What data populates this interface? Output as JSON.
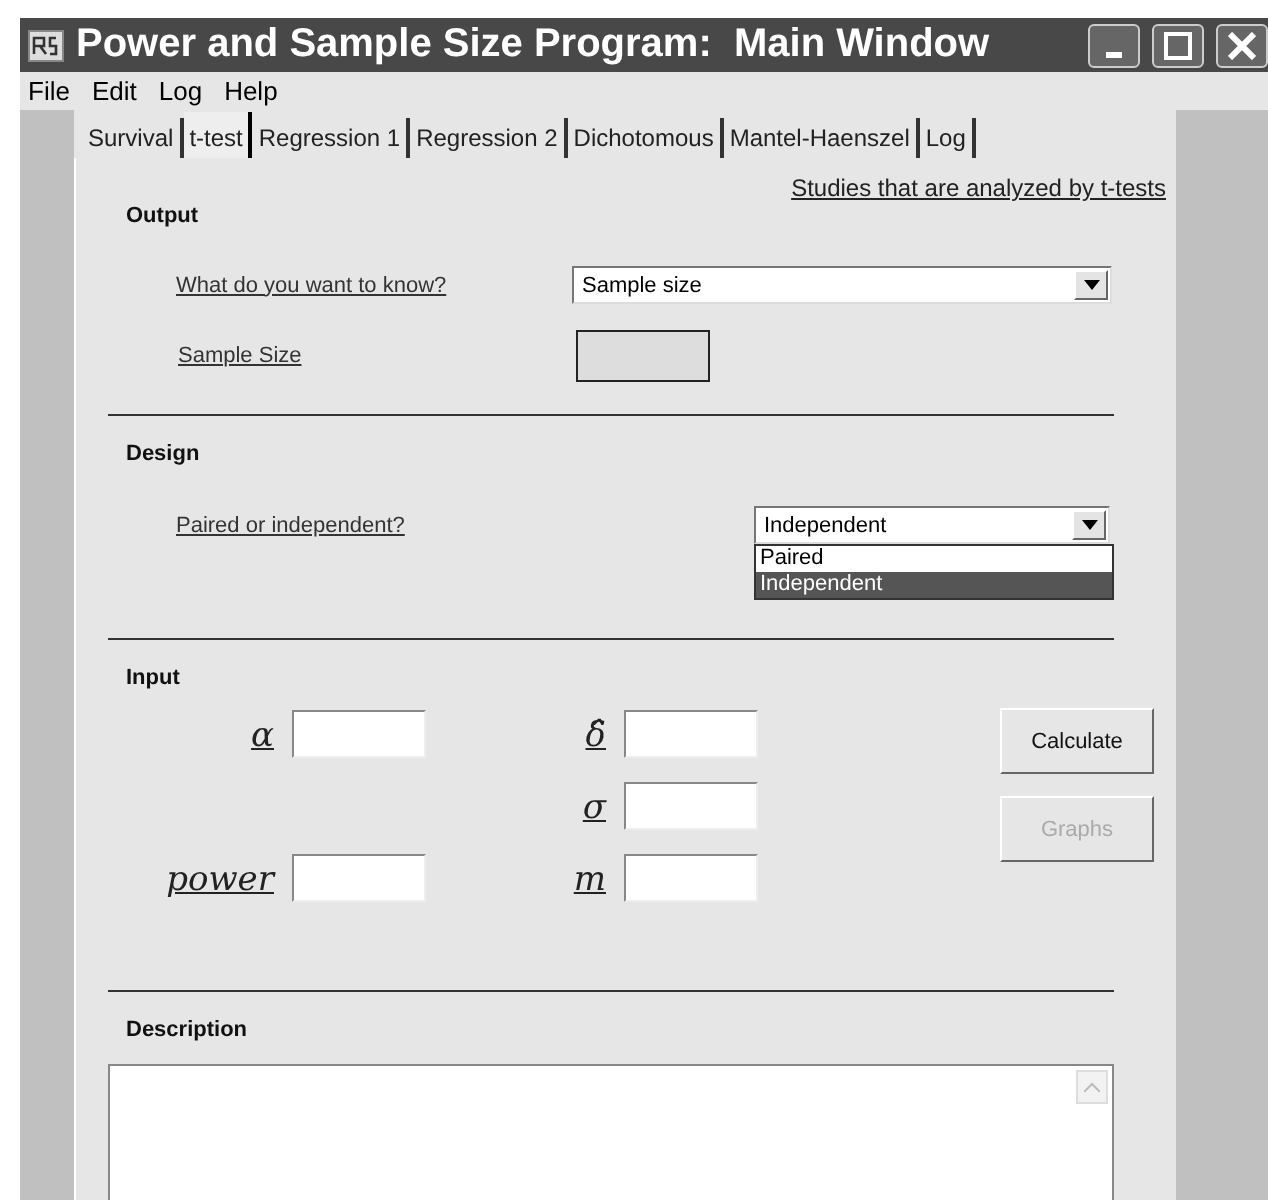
{
  "window": {
    "title": "Power and Sample Size Program:  Main Window"
  },
  "menu": [
    "File",
    "Edit",
    "Log",
    "Help"
  ],
  "tabs": [
    {
      "label": "Survival",
      "selected": false
    },
    {
      "label": "t-test",
      "selected": true
    },
    {
      "label": "Regression 1",
      "selected": false
    },
    {
      "label": "Regression 2",
      "selected": false
    },
    {
      "label": "Dichotomous",
      "selected": false
    },
    {
      "label": "Mantel-Haenszel",
      "selected": false
    },
    {
      "label": "Log",
      "selected": false
    }
  ],
  "link": "Studies that are analyzed by t-tests",
  "output": {
    "heading": "Output",
    "question": {
      "label": "What do you want to know?",
      "value": "Sample size"
    },
    "result": {
      "label": "Sample Size"
    }
  },
  "design": {
    "heading": "Design",
    "question": {
      "label": "Paired or independent?",
      "value": "Independent",
      "expanded": true,
      "options": [
        {
          "label": "Paired",
          "selected": false
        },
        {
          "label": "Independent",
          "selected": true
        }
      ]
    }
  },
  "input": {
    "heading": "Input",
    "rows": [
      {
        "left": {
          "label": "α"
        },
        "right": {
          "label": "δ̂"
        }
      },
      {
        "right": {
          "label": "σ"
        }
      },
      {
        "left": {
          "label": "power"
        },
        "right": {
          "label": "m"
        }
      }
    ]
  },
  "buttons": [
    {
      "label": "Calculate",
      "disabled": false
    },
    {
      "label": "Graphs",
      "disabled": true
    }
  ],
  "description": {
    "heading": "Description"
  }
}
